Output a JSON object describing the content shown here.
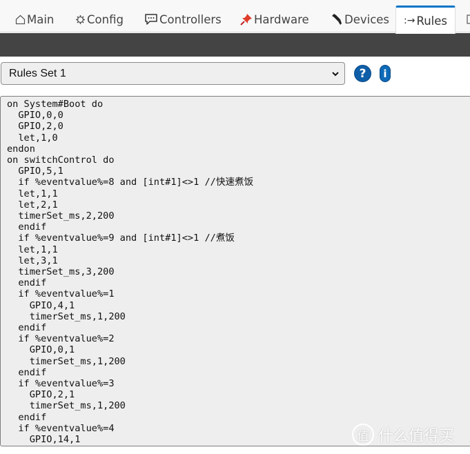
{
  "tabs": [
    {
      "label": "Main",
      "icon": "home-icon",
      "glyph": "⌂"
    },
    {
      "label": "Config",
      "icon": "gear-icon",
      "glyph": "⚙"
    },
    {
      "label": "Controllers",
      "icon": "speech-bubble-icon",
      "glyph": ""
    },
    {
      "label": "Hardware",
      "icon": "pushpin-icon",
      "glyph": ""
    },
    {
      "label": "Devices",
      "icon": "plug-icon",
      "glyph": ""
    },
    {
      "label": "Rules",
      "icon": "arrow-right-icon",
      "glyph": ":→",
      "active": true
    },
    {
      "label": "",
      "icon": "notes-icon",
      "glyph": ""
    }
  ],
  "colors": {
    "active_tab_accent": "#0073c7",
    "dark_bar": "#444444",
    "help_button": "#0f5ea8",
    "editor_bg": "#eeeeee"
  },
  "rules": {
    "selected_set": "Rules Set 1",
    "help_label": "?",
    "info_label": "i",
    "code": "on System#Boot do\n  GPIO,0,0\n  GPIO,2,0\n  let,1,0\nendon\non switchControl do\n  GPIO,5,1\n  if %eventvalue%=8 and [int#1]<>1 //快速煮饭\n  let,1,1\n  let,2,1\n  timerSet_ms,2,200\n  endif\n  if %eventvalue%=9 and [int#1]<>1 //煮饭\n  let,1,1\n  let,3,1\n  timerSet_ms,3,200\n  endif\n  if %eventvalue%=1\n    GPIO,4,1\n    timerSet_ms,1,200\n  endif\n  if %eventvalue%=2\n    GPIO,0,1\n    timerSet_ms,1,200\n  endif\n  if %eventvalue%=3\n    GPIO,2,1\n    timerSet_ms,1,200\n  endif\n  if %eventvalue%=4\n    GPIO,14,1\n    timerSet_ms,1,200"
  },
  "watermark": {
    "badge": "值",
    "text": "什么值得买"
  }
}
